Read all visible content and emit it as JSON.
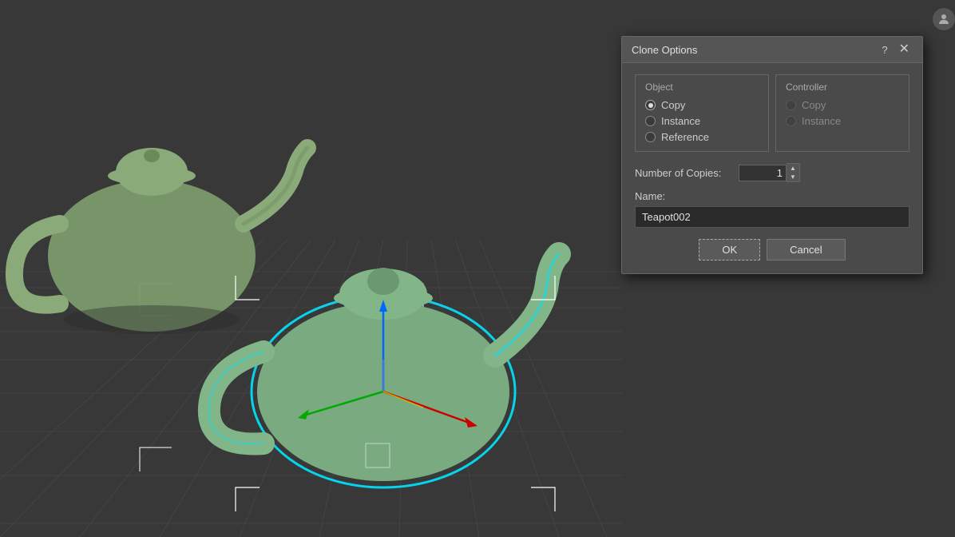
{
  "viewport": {
    "background": "#383838"
  },
  "dialog": {
    "title": "Clone Options",
    "help_label": "?",
    "close_label": "✕",
    "object_section": {
      "label": "Object",
      "options": [
        {
          "id": "copy",
          "label": "Copy",
          "selected": true,
          "disabled": false
        },
        {
          "id": "instance",
          "label": "Instance",
          "selected": false,
          "disabled": false
        },
        {
          "id": "reference",
          "label": "Reference",
          "selected": false,
          "disabled": false
        }
      ]
    },
    "controller_section": {
      "label": "Controller",
      "options": [
        {
          "id": "copy",
          "label": "Copy",
          "selected": false,
          "disabled": true
        },
        {
          "id": "instance",
          "label": "Instance",
          "selected": false,
          "disabled": true
        }
      ]
    },
    "number_of_copies": {
      "label": "Number of Copies:",
      "value": "1"
    },
    "name": {
      "label": "Name:",
      "value": "Teapot002"
    },
    "ok_button": "OK",
    "cancel_button": "Cancel"
  }
}
